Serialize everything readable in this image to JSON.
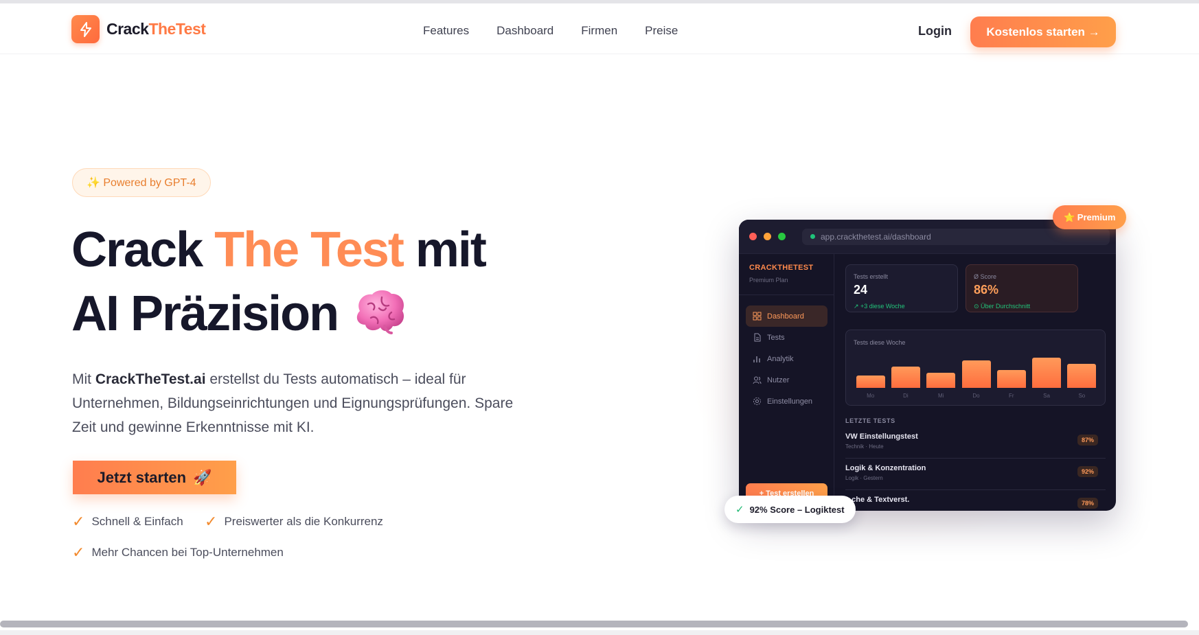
{
  "brand": {
    "part1": "Crack",
    "part2": "TheTest",
    "accent": "#ff7a45"
  },
  "nav": {
    "items": [
      {
        "label": "Features"
      },
      {
        "label": "Dashboard"
      },
      {
        "label": "Firmen"
      },
      {
        "label": "Preise"
      }
    ],
    "login": "Login",
    "cta": "Kostenlos starten →"
  },
  "hero": {
    "badge": "✨ Powered by GPT-4",
    "title_part1": "Crack",
    "title_highlight": "The Test",
    "title_part2": "mit",
    "title_line2": "AI Präzision",
    "desc_prefix": "Mit",
    "desc_brand": "CrackTheTest.ai",
    "desc_suffix": "erstellst du Tests automatisch – ideal für Unternehmen, Bildungseinrichtungen und Eignungsprüfungen. Spare Zeit und gewinne Erkenntnisse mit KI.",
    "cta": "Jetzt starten",
    "cta_icon": "🚀",
    "features": [
      "Schnell & Einfach",
      "Preiswerter als die Konkurrenz",
      "Mehr Chancen bei Top-Unternehmen"
    ]
  },
  "mockup": {
    "url": "app.crackthetest.ai/dashboard",
    "sidebar": {
      "brand": "CRACKTHETEST",
      "plan": "Premium Plan",
      "items": [
        {
          "label": "Dashboard",
          "icon": "grid-icon"
        },
        {
          "label": "Tests",
          "icon": "document-icon"
        },
        {
          "label": "Analytik",
          "icon": "bar-chart-icon"
        },
        {
          "label": "Nutzer",
          "icon": "users-icon"
        },
        {
          "label": "Einstellungen",
          "icon": "gear-icon"
        }
      ],
      "create_button": "+ Test erstellen"
    },
    "stats": [
      {
        "label": "Tests erstellt",
        "value": "24",
        "sub": "↗ +3 diese Woche"
      },
      {
        "label": "Ø Score",
        "value": "86%",
        "sub": "⊙ Über Durchschnitt"
      }
    ],
    "chart_title": "Tests diese Woche",
    "recent_title": "LETZTE TESTS",
    "recent": [
      {
        "name": "VW Einstellungstest",
        "meta": "Technik · Heute",
        "score": "87%"
      },
      {
        "name": "Logik & Konzentration",
        "meta": "Logik · Gestern",
        "score": "92%"
      },
      {
        "name": "...che & Textverst.",
        "meta": "",
        "score": "78%"
      }
    ],
    "premium_badge": "⭐ Premium",
    "toast": "92% Score – Logiktest"
  },
  "chart_data": {
    "type": "bar",
    "categories": [
      "Mo",
      "Di",
      "Mi",
      "Do",
      "Fr",
      "Sa",
      "So"
    ],
    "values": [
      4,
      7,
      5,
      9,
      6,
      10,
      8
    ],
    "title": "Tests diese Woche",
    "ylim": [
      0,
      10
    ]
  }
}
